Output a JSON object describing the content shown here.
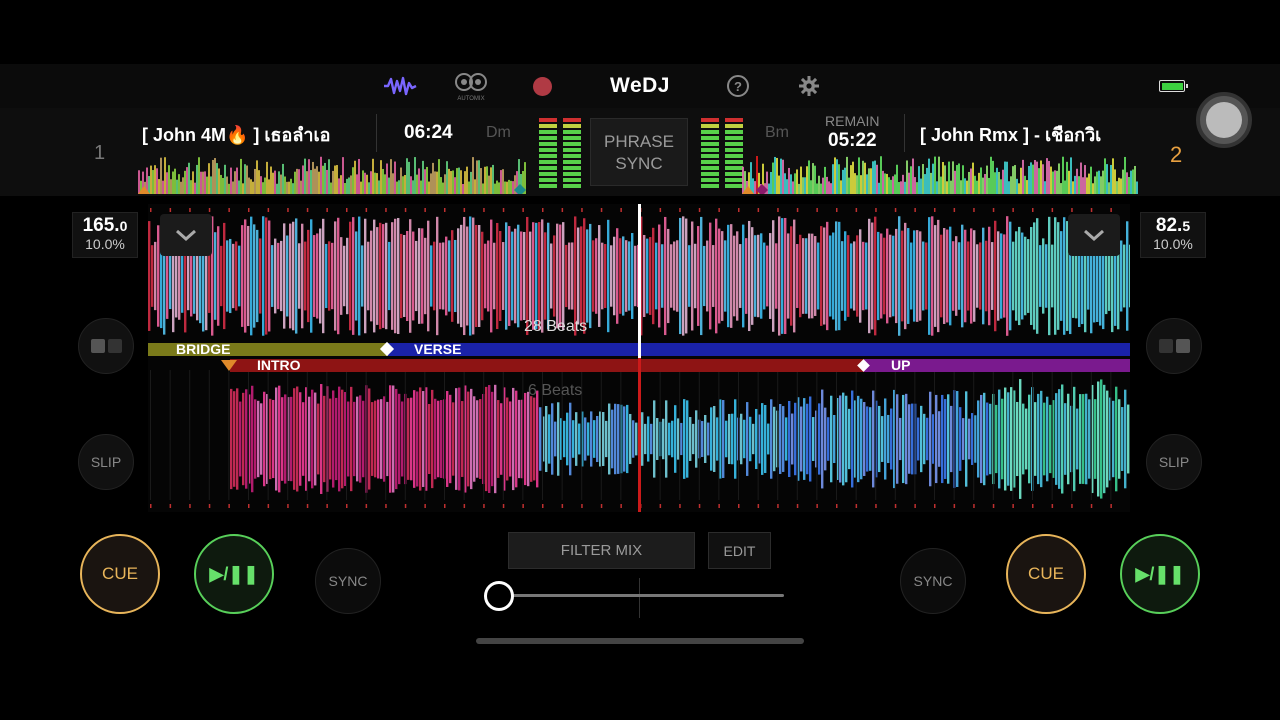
{
  "app": {
    "brand": "WeDJ",
    "automix_label": "AUTOMIX",
    "icons": [
      "waveform-icon",
      "automix-icon",
      "record-icon",
      "help-icon",
      "settings-icon",
      "battery-icon"
    ]
  },
  "deck1": {
    "number": "1",
    "title": "[ John 4M🔥 ] เธอลำเอ",
    "time": "06:24",
    "key": "Dm",
    "bpm": "165.",
    "bpm_decimal": "0",
    "pitch": "10.0%",
    "slip_label": "SLIP",
    "cue_label": "CUE",
    "play_label": "▶/❚❚",
    "sync_label": "SYNC"
  },
  "deck2": {
    "number": "2",
    "title": "[ John Rmx ] - เชือกวิเ",
    "remain_label": "REMAIN",
    "time": "05:22",
    "key": "Bm",
    "bpm": "82.",
    "bpm_decimal": "5",
    "pitch": "10.0%",
    "slip_label": "SLIP",
    "cue_label": "CUE",
    "play_label": "▶/❚❚",
    "sync_label": "SYNC"
  },
  "center": {
    "phrase_sync_line1": "PHRASE",
    "phrase_sync_line2": "SYNC",
    "filter_mix": "FILTER MIX",
    "edit": "EDIT",
    "filter_value": 0.0
  },
  "waveform": {
    "beats_a": "28 Beats",
    "beats_b": "6 Beats",
    "phrases_a": [
      {
        "label": "BRIDGE",
        "color": "#7a7a1a"
      },
      {
        "label": "VERSE",
        "color": "#1a22a8"
      }
    ],
    "phrases_b": [
      {
        "label": "INTRO",
        "color": "#8e1414"
      },
      {
        "label": "UP",
        "color": "#7a1a8e"
      }
    ]
  },
  "colors": {
    "cue": "#e8b55a",
    "play": "#58d05a",
    "deck2_number": "#e8a040",
    "playhead_a": "#ffffff",
    "playhead_b": "#cc1a1a"
  }
}
